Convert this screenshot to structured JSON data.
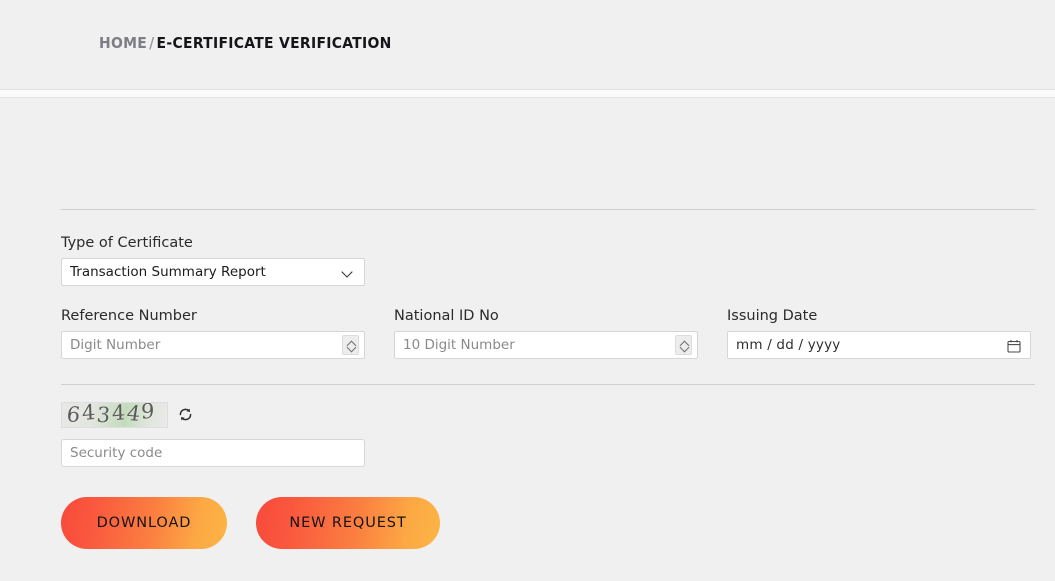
{
  "page": {
    "background_color": "#f0f0f0"
  },
  "header": {
    "breadcrumb": {
      "home_label": "HOME",
      "separator": "/",
      "current_label": "E-CERTIFICATE VERIFICATION"
    }
  },
  "form": {
    "certificate_type": {
      "label": "Type of Certificate",
      "selected": "Transaction Summary Report",
      "options": [
        "Transaction Summary Report"
      ],
      "icon": "chevron-down-icon"
    },
    "reference_number": {
      "label": "Reference Number",
      "value": "",
      "placeholder": "Digit Number",
      "control": "number-spinner"
    },
    "national_id": {
      "label": "National ID No",
      "value": "",
      "placeholder": "10 Digit Number",
      "control": "number-spinner"
    },
    "issuing_date": {
      "label": "Issuing Date",
      "value": "",
      "placeholder": "mm / dd / yyyy",
      "icon": "calendar-icon"
    },
    "captcha": {
      "code": "643449",
      "refresh_icon": "refresh-icon"
    },
    "security_code": {
      "value": "",
      "placeholder": "Security code"
    }
  },
  "actions": {
    "download_label": "DOWNLOAD",
    "new_request_label": "NEW REQUEST",
    "gradient_start": "#f8493b",
    "gradient_end": "#fcb544"
  }
}
